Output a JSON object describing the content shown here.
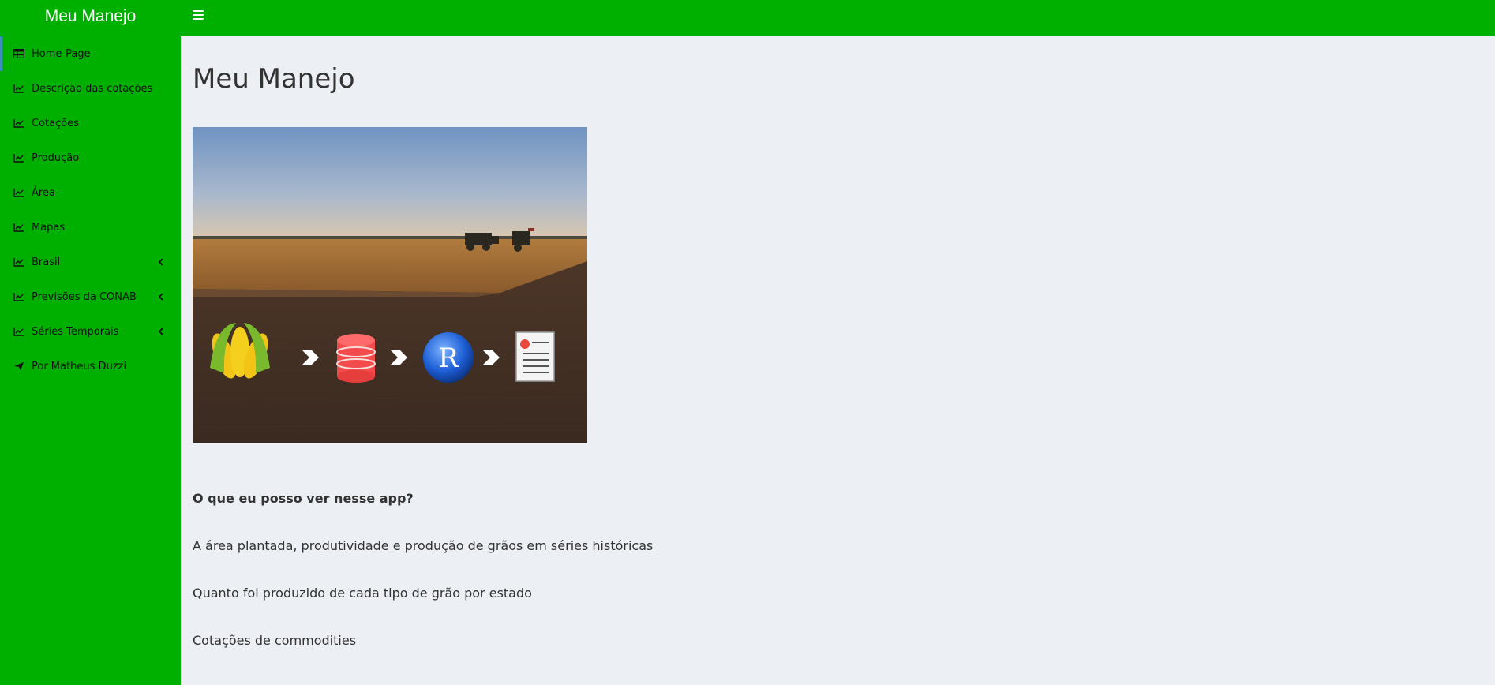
{
  "app": {
    "title": "Meu Manejo"
  },
  "header": {
    "toggle_icon": "hamburger-icon",
    "background": "#00b000"
  },
  "sidebar": {
    "background": "#00b000",
    "active_border": "#3c8dbc",
    "items": [
      {
        "label": "Home-Page",
        "icon": "table-icon"
      },
      {
        "label": "Descrição das cotações",
        "icon": "line-chart-icon"
      },
      {
        "label": "Cotações",
        "icon": "line-chart-icon"
      },
      {
        "label": "Produção",
        "icon": "line-chart-icon"
      },
      {
        "label": "Área",
        "icon": "line-chart-icon"
      },
      {
        "label": "Mapas",
        "icon": "line-chart-icon"
      },
      {
        "label": "Brasil",
        "icon": "line-chart-icon",
        "expandable": true
      },
      {
        "label": "Previsões da CONAB",
        "icon": "line-chart-icon",
        "expandable": true
      },
      {
        "label": "Séries Temporais",
        "icon": "line-chart-icon",
        "expandable": true
      },
      {
        "label": "Por Matheus Duzzi",
        "icon": "paper-plane-icon"
      }
    ]
  },
  "main": {
    "title": "Meu Manejo",
    "question": "O que eu posso ver nesse app?",
    "paragraphs": [
      "A área plantada, produtividade e produção de grãos em séries históricas",
      "Quanto foi produzido de cada tipo de grão por estado",
      "Cotações de commodities"
    ],
    "banner_r_letter": "R"
  }
}
